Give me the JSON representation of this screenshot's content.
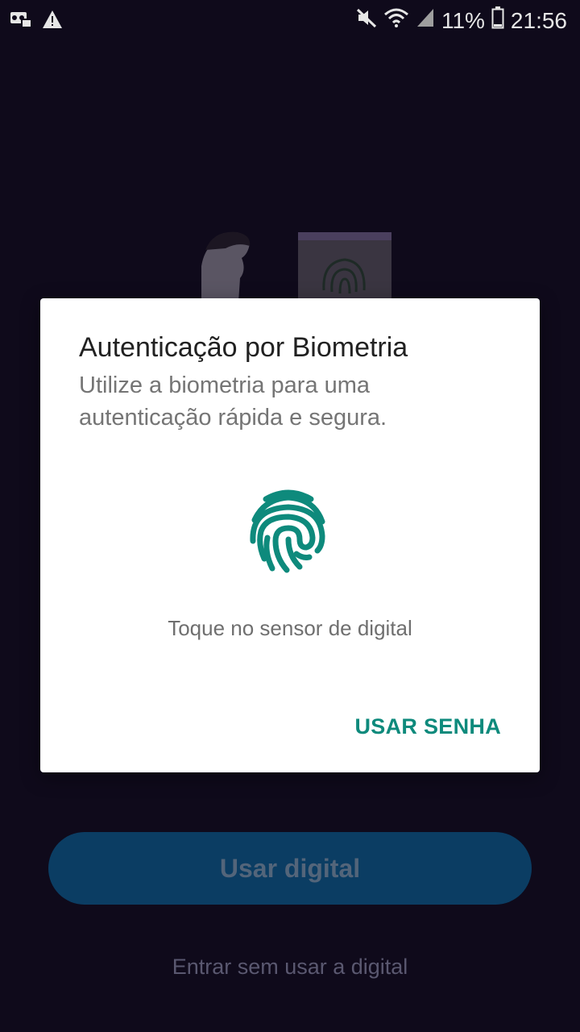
{
  "status_bar": {
    "left_icons": [
      "voicemail-icon",
      "warning-icon"
    ],
    "right_icons": [
      "mute-icon",
      "wifi-icon",
      "signal-icon",
      "battery-icon"
    ],
    "battery_percent": "11%",
    "time": "21:56"
  },
  "dialog": {
    "title": "Autenticação por Biometria",
    "subtitle": "Utilize a biometria para uma autenticação rápida e segura.",
    "icon": "fingerprint-icon",
    "hint": "Toque no sensor de digital",
    "secondary_action": "USAR SENHA",
    "accent_color": "#0e8a7c"
  },
  "background": {
    "primary_button": "Usar digital",
    "link": "Entrar sem usar a digital"
  }
}
